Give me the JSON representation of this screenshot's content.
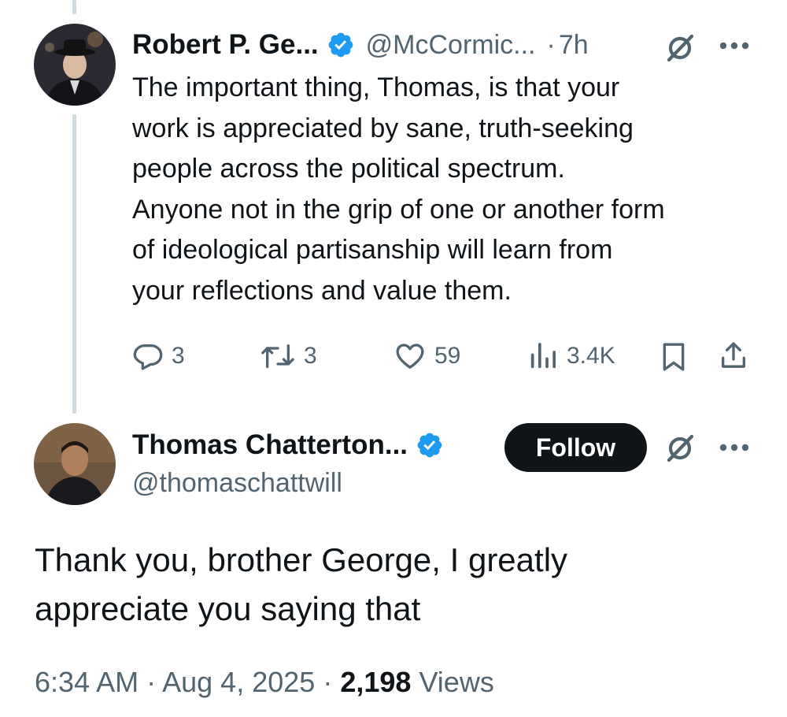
{
  "parent_tweet": {
    "author_name": "Robert P. Ge...",
    "author_handle": "@McCormic...",
    "separator": "·",
    "time": "7h",
    "lines": [
      "The important thing, Thomas, is that your",
      "work is appreciated by sane, truth-seeking",
      "people across the political spectrum.",
      "Anyone not in the grip of one or another form",
      "of ideological partisanship will learn from",
      "your reflections and value them."
    ],
    "replies": "3",
    "reposts": "3",
    "likes": "59",
    "views": "3.4K"
  },
  "reply_tweet": {
    "author_name": "Thomas Chatterton...",
    "author_handle": "@thomaschattwill",
    "follow_label": "Follow",
    "lines": [
      "Thank you, brother George, I greatly",
      "appreciate you saying that"
    ],
    "time": "6:34 AM",
    "sep1": "·",
    "date": "Aug 4, 2025",
    "sep2": "·",
    "views_count": "2,198",
    "views_label": "Views"
  },
  "colors": {
    "verified": "#1d9bf0",
    "text_primary": "#0f1419",
    "text_secondary": "#536471",
    "follow_bg": "#0f1419",
    "thread_line": "#cfd9de"
  },
  "icons": [
    "verified-badge-icon",
    "grok-icon",
    "more-icon",
    "reply-icon",
    "repost-icon",
    "like-icon",
    "views-icon",
    "bookmark-icon",
    "share-icon"
  ]
}
